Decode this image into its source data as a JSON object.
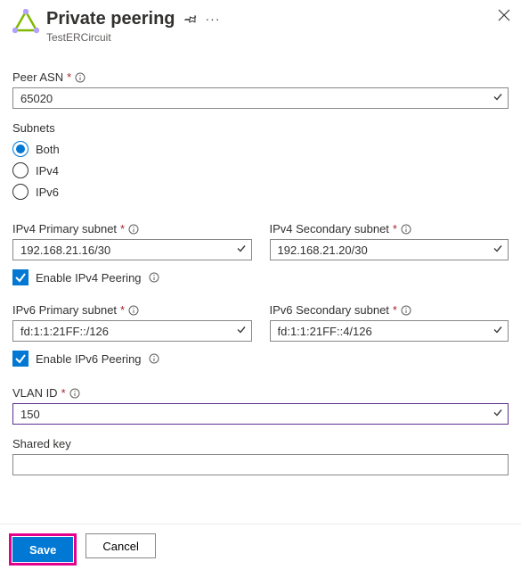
{
  "header": {
    "title": "Private peering",
    "subtitle": "TestERCircuit"
  },
  "peer_asn": {
    "label": "Peer ASN",
    "value": "65020"
  },
  "subnets": {
    "label": "Subnets",
    "options": {
      "both": "Both",
      "ipv4": "IPv4",
      "ipv6": "IPv6"
    },
    "selected": "both"
  },
  "ipv4": {
    "primary_label": "IPv4 Primary subnet",
    "primary_value": "192.168.21.16/30",
    "secondary_label": "IPv4 Secondary subnet",
    "secondary_value": "192.168.21.20/30",
    "enable_label": "Enable IPv4 Peering",
    "enable_checked": true
  },
  "ipv6": {
    "primary_label": "IPv6 Primary subnet",
    "primary_value": "fd:1:1:21FF::/126",
    "secondary_label": "IPv6 Secondary subnet",
    "secondary_value": "fd:1:1:21FF::4/126",
    "enable_label": "Enable IPv6 Peering",
    "enable_checked": true
  },
  "vlan": {
    "label": "VLAN ID",
    "value": "150"
  },
  "shared_key": {
    "label": "Shared key",
    "value": ""
  },
  "footer": {
    "save": "Save",
    "cancel": "Cancel"
  }
}
